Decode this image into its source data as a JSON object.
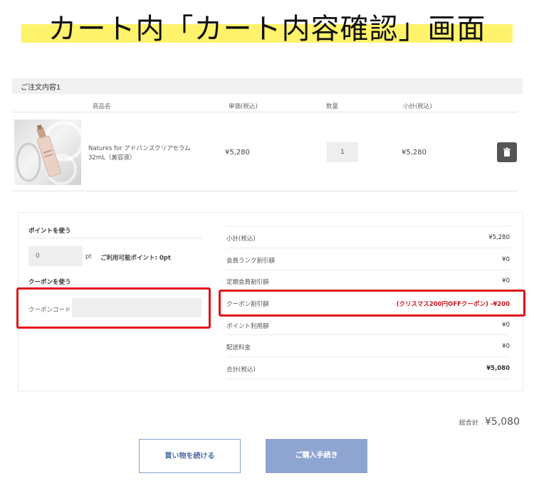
{
  "page": {
    "heading": "カート内「カート内容確認」画面"
  },
  "order": {
    "header": "ご注文内容1",
    "columns": {
      "product": "商品名",
      "unit_price": "単価(税込)",
      "quantity": "数量",
      "subtotal": "小計(税込)"
    },
    "items": [
      {
        "name": "Natures for アドバンスクリアセラム　32mL（美容液）",
        "unit_price": "¥5,280",
        "quantity": "1",
        "subtotal": "¥5,280",
        "image_icon": "serum-bottle-image",
        "delete_icon": "trash-icon"
      }
    ]
  },
  "points": {
    "heading": "ポイントを使う",
    "input_value": "0",
    "unit": "pt",
    "available_label": "ご利用可能ポイント: 0pt"
  },
  "coupon": {
    "heading": "クーポンを使う",
    "code_label": "クーポンコード",
    "code_value": ""
  },
  "summary": {
    "rows": [
      {
        "label": "小計(税込)",
        "value": "¥5,280"
      },
      {
        "label": "会員ランク割引額",
        "value": "¥0"
      },
      {
        "label": "定期会員割引額",
        "value": "¥0"
      },
      {
        "label": "クーポン割引額",
        "value": "(クリスマス200円OFFクーポン) -¥200"
      },
      {
        "label": "ポイント利用額",
        "value": "¥0"
      },
      {
        "label": "配送料金",
        "value": "¥0"
      },
      {
        "label": "合計(税込)",
        "value": "¥5,080"
      }
    ]
  },
  "total": {
    "label": "総合計",
    "value": "¥5,080"
  },
  "buttons": {
    "continue_shopping": "買い物を続ける",
    "checkout": "ご購入手続き"
  },
  "colors": {
    "highlight_band": "#fff36b",
    "annotation_red": "#e0141b",
    "coupon_discount_text": "#c8161d",
    "button_blue": "#8ea5d2"
  }
}
